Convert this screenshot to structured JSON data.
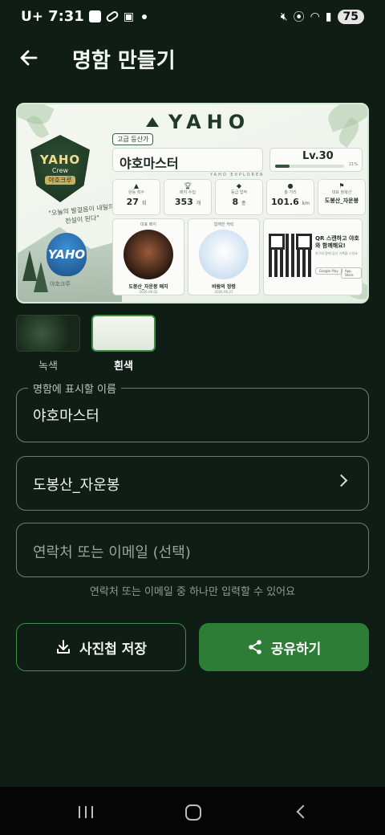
{
  "status_bar": {
    "carrier": "U+",
    "time": "7:31",
    "battery": "75"
  },
  "header": {
    "title": "명함 만들기",
    "back_icon": "arrow-left-icon"
  },
  "card": {
    "brand": "YAHO",
    "crest_title": "YAHO",
    "crest_sub": "Crew",
    "crest_tag": "야호크루",
    "slogan": "\"오늘의 발걸음이 내일의 전설이 된다\"",
    "logo_text": "YAHO",
    "logo_caption": "야호크루",
    "grade": "고급 등산가",
    "name": "야호마스터",
    "level": "Lv.30",
    "level_progress": 0.21,
    "level_pct_text": "21%",
    "explorer_label": "YAHO EXPLORER",
    "stats": [
      {
        "icon": "mountain-icon",
        "label": "완등 횟수",
        "value": "27",
        "unit": "회"
      },
      {
        "icon": "trophy-icon",
        "label": "배지 수집",
        "value": "353",
        "unit": "개"
      },
      {
        "icon": "gem-icon",
        "label": "등급 업적",
        "value": "8",
        "unit": "종"
      },
      {
        "icon": "pin-icon",
        "label": "총 거리",
        "value": "101.6",
        "unit": "km"
      },
      {
        "icon": "flag-icon",
        "label": "대표 정복산",
        "value": "도봉산_자운봉",
        "unit": ""
      }
    ],
    "badges": [
      {
        "title": "대표 배지",
        "name": "도봉산_자운봉 배지",
        "date": "2026.06.02"
      },
      {
        "title": "함께한 캐릭",
        "name": "바람의 정령",
        "date": "2026.06.27"
      }
    ],
    "qr_title": "QR 스캔하고 야호와 함께해요!",
    "qr_sub": "친구와 함께 등산 기록을 나눠요",
    "store_google": "Google Play",
    "store_apple": "App Store"
  },
  "themes": [
    {
      "label": "녹색",
      "selected": false
    },
    {
      "label": "흰색",
      "selected": true
    }
  ],
  "form": {
    "name_label": "명함에 표시할 이름",
    "name_value": "야호마스터",
    "mountain_value": "도봉산_자운봉",
    "contact_placeholder": "연락처 또는 이메일 (선택)",
    "helper": "연락처 또는 이메일 중 하나만 입력할 수 있어요"
  },
  "actions": {
    "save_label": "사진첩 저장",
    "save_icon": "download-icon",
    "share_label": "공유하기",
    "share_icon": "share-icon"
  },
  "colors": {
    "background": "#0f1d14",
    "accent": "#2e7d37"
  }
}
